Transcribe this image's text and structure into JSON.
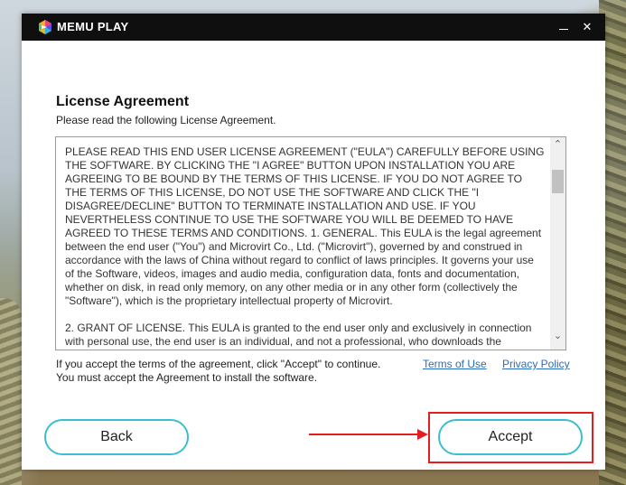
{
  "window": {
    "brand": "MEMU PLAY",
    "minimize_icon": "minimize-icon",
    "close_label": "✕"
  },
  "content": {
    "heading": "License Agreement",
    "subheading": "Please read the following License Agreement.",
    "eula_paragraphs": [
      "PLEASE READ THIS END USER LICENSE AGREEMENT (\"EULA\") CAREFULLY BEFORE USING THE SOFTWARE. BY CLICKING THE \"I AGREE\" BUTTON UPON INSTALLATION YOU ARE AGREEING TO BE BOUND BY THE TERMS OF THIS LICENSE. IF YOU DO NOT AGREE TO THE TERMS OF THIS LICENSE, DO NOT USE THE SOFTWARE AND CLICK THE \"I DISAGREE/DECLINE\" BUTTON TO TERMINATE INSTALLATION AND USE. IF YOU NEVERTHELESS CONTINUE TO USE THE SOFTWARE YOU WILL BE DEEMED TO HAVE AGREED TO THESE TERMS AND CONDITIONS. 1. GENERAL. This EULA is the legal agreement between the end user (\"You\") and Microvirt Co., Ltd. (\"Microvirt\"), governed by and construed in accordance with the laws of China without regard to conflict of laws principles. It governs your use of the Software, videos, images and audio media, configuration data, fonts and documentation, whether on disk, in read only memory, on any other media or in any other form (collectively the \"Software\"), which is the proprietary intellectual property of Microvirt.",
      "2. GRANT OF LICENSE. This EULA is granted to the end user only and exclusively in connection with personal use, the end user is an individual, and not a professional, who downloads the"
    ],
    "accept_note_line1": "If you accept the terms of the agreement, click \"Accept\" to continue.",
    "accept_note_line2": "You must accept the Agreement to install the software.",
    "terms_link": "Terms of Use",
    "privacy_link": "Privacy Policy"
  },
  "buttons": {
    "back": "Back",
    "accept": "Accept"
  },
  "colors": {
    "accent": "#3bbfcf",
    "annotation": "#e41e1e",
    "link": "#2a6ebb"
  }
}
